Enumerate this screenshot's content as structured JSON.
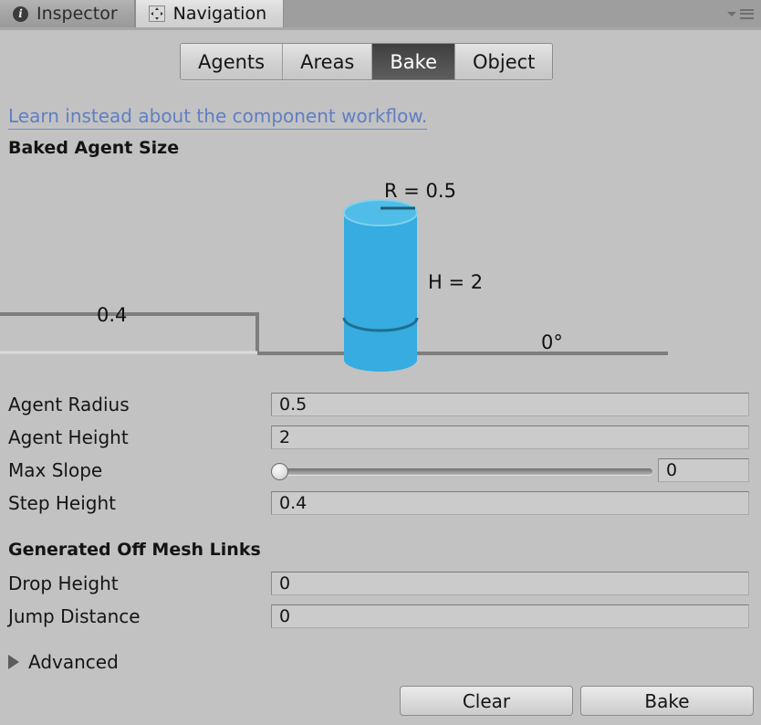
{
  "window": {
    "tabs": [
      {
        "label": "Inspector",
        "icon": "info-circle-icon",
        "active": false
      },
      {
        "label": "Navigation",
        "icon": "navigation-move-icon",
        "active": true
      }
    ],
    "menu_caret_icon": "chevron-down-icon",
    "menu_icon": "hamburger-menu-icon"
  },
  "toolbar": {
    "tabs": [
      {
        "label": "Agents",
        "selected": false
      },
      {
        "label": "Areas",
        "selected": false
      },
      {
        "label": "Bake",
        "selected": true
      },
      {
        "label": "Object",
        "selected": false
      }
    ]
  },
  "link": {
    "text": "Learn instead about the component workflow.",
    "color": "#5f7fc4"
  },
  "sections": {
    "baked_agent_size": "Baked Agent Size",
    "generated_off_mesh_links": "Generated Off Mesh Links"
  },
  "diagram": {
    "radius_label": "R = 0.5",
    "height_label": "H = 2",
    "step_label": "0.4",
    "slope_label": "0°",
    "cylinder_color": "#36ace0",
    "cylinder_top_color": "#4fbde8",
    "line_color": "#7d7d7d"
  },
  "properties": [
    {
      "label": "Agent Radius",
      "value": "0.5",
      "type": "text"
    },
    {
      "label": "Agent Height",
      "value": "2",
      "type": "text"
    },
    {
      "label": "Max Slope",
      "value": "0",
      "type": "slider",
      "slider_percent": 0
    },
    {
      "label": "Step Height",
      "value": "0.4",
      "type": "text"
    }
  ],
  "off_mesh_properties": [
    {
      "label": "Drop Height",
      "value": "0",
      "type": "text"
    },
    {
      "label": "Jump Distance",
      "value": "0",
      "type": "text"
    }
  ],
  "advanced": {
    "label": "Advanced",
    "expanded": false,
    "icon": "triangle-right-icon"
  },
  "actions": {
    "clear_label": "Clear",
    "bake_label": "Bake"
  }
}
